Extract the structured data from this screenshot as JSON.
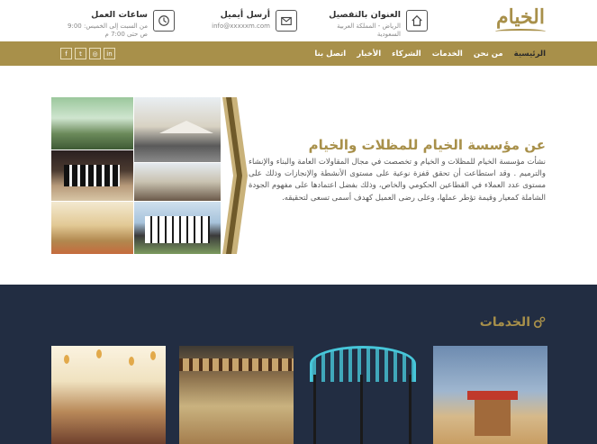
{
  "logo": {
    "text": "الخيام"
  },
  "header": {
    "address": {
      "title": "العنوان بالتفصيل",
      "line1": "الرياض - المملكة العربية",
      "line2": "السعودية",
      "icon": "home-icon"
    },
    "email": {
      "title": "أرسل أيميل",
      "value": "info@xxxxxm.com",
      "icon": "envelope-icon"
    },
    "hours": {
      "title": "ساعات العمل",
      "line1": "من السبت إلى الخميس: 9:00",
      "line2": "ص حتى 7:00 م",
      "icon": "clock-icon"
    }
  },
  "nav": {
    "items": [
      {
        "label": "الرئيسية",
        "active": true
      },
      {
        "label": "من نحن"
      },
      {
        "label": "الخدمات"
      },
      {
        "label": "الشركاء"
      },
      {
        "label": "الأخبار"
      },
      {
        "label": "اتصل بنا"
      }
    ]
  },
  "social": [
    {
      "name": "linkedin-icon",
      "glyph": "in"
    },
    {
      "name": "instagram-icon",
      "glyph": "◎"
    },
    {
      "name": "twitter-icon",
      "glyph": "t"
    },
    {
      "name": "facebook-icon",
      "glyph": "f"
    }
  ],
  "about": {
    "title": "عن مؤسسة الخيام للمظلات والخيام",
    "text": "نشأت مؤسسة الخيام للمظلات و الخيام و تخصصت في مجال المقاولات العامة والبناء والإنشاء والترميم . وقد استطاعت أن تحقق قفزة نوعية على مستوى الأنشطة والإنجازات وذلك على مستوى عدد العملاء في القطاعين الحكومي والخاص، وذلك بفضل اعتمادها على مفهوم الجودة الشاملة كمعيار وقيمة تؤطر عملها، وعلى رضى العميل كهدف أسمى تسعى لتحقيقه."
  },
  "services": {
    "title": "الخدمات",
    "icon": "gears-icon"
  },
  "colors": {
    "gold": "#a8904a",
    "navy": "#222d42"
  }
}
